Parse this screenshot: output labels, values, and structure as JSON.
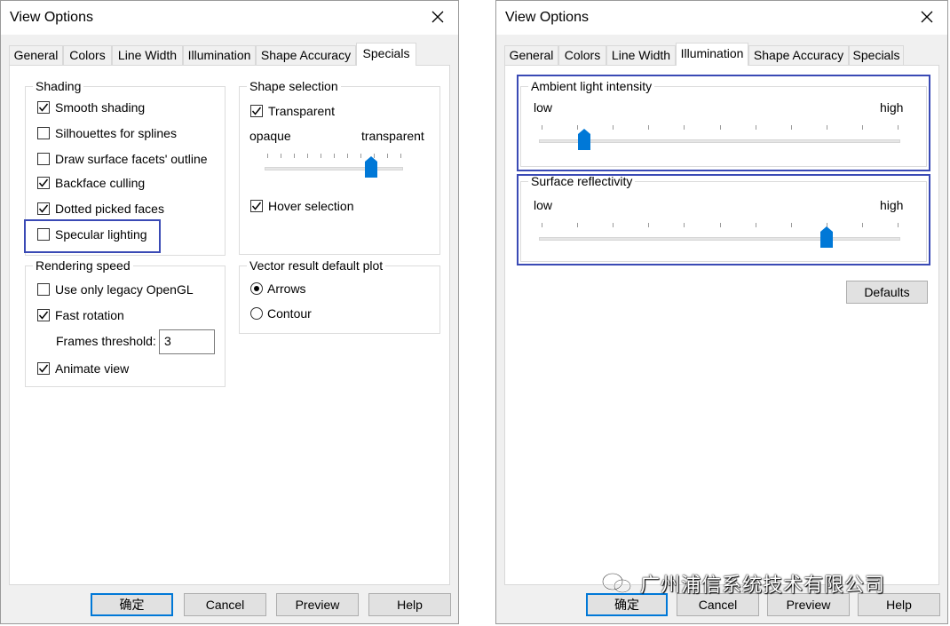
{
  "left_dialog": {
    "title": "View Options",
    "tabs": [
      "General",
      "Colors",
      "Line Width",
      "Illumination",
      "Shape Accuracy",
      "Specials"
    ],
    "active_tab": "Specials",
    "shading": {
      "legend": "Shading",
      "items": [
        {
          "label": "Smooth shading",
          "checked": true
        },
        {
          "label": "Silhouettes for splines",
          "checked": false
        },
        {
          "label": "Draw surface facets' outline",
          "checked": false
        },
        {
          "label": "Backface culling",
          "checked": true
        },
        {
          "label": "Dotted picked faces",
          "checked": true
        },
        {
          "label": "Specular lighting",
          "checked": false
        }
      ]
    },
    "rendering_speed": {
      "legend": "Rendering speed",
      "legacy_opengl": {
        "label": "Use only legacy OpenGL",
        "checked": false
      },
      "fast_rotation": {
        "label": "Fast rotation",
        "checked": true
      },
      "frames_threshold_label": "Frames threshold:",
      "frames_threshold_value": "3",
      "animate_view": {
        "label": "Animate view",
        "checked": true
      }
    },
    "shape_selection": {
      "legend": "Shape selection",
      "transparent": {
        "label": "Transparent",
        "checked": true
      },
      "slider_min_label": "opaque",
      "slider_max_label": "transparent",
      "slider_level": 0.78,
      "hover": {
        "label": "Hover selection",
        "checked": true
      }
    },
    "vector_plot": {
      "legend": "Vector result default plot",
      "options": [
        {
          "label": "Arrows",
          "selected": true
        },
        {
          "label": "Contour",
          "selected": false
        }
      ]
    },
    "buttons": {
      "ok": "确定",
      "cancel": "Cancel",
      "preview": "Preview",
      "help": "Help"
    }
  },
  "right_dialog": {
    "title": "View Options",
    "tabs": [
      "General",
      "Colors",
      "Line Width",
      "Illumination",
      "Shape Accuracy",
      "Specials"
    ],
    "active_tab": "Illumination",
    "ambient": {
      "legend": "Ambient light intensity",
      "low_label": "low",
      "high_label": "high",
      "level": 0.12
    },
    "reflectivity": {
      "legend": "Surface reflectivity",
      "low_label": "low",
      "high_label": "high",
      "level": 0.8
    },
    "defaults_button": "Defaults",
    "buttons": {
      "ok": "确定",
      "cancel": "Cancel",
      "preview": "Preview",
      "help": "Help"
    }
  },
  "watermark": {
    "text": "广州浦信系统技术有限公司",
    "icon": "wechat-icon"
  },
  "colors": {
    "accent": "#0078d7",
    "highlight": "#3a4ab5",
    "dialog_bg": "#f0f0f0"
  }
}
